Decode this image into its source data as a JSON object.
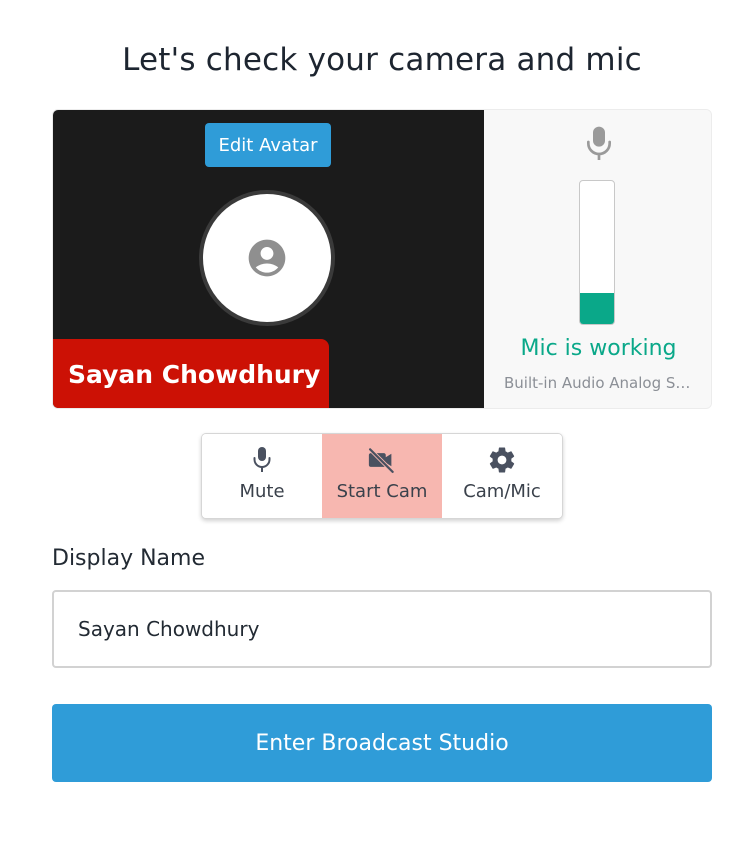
{
  "page": {
    "title": "Let's check your camera and mic"
  },
  "preview": {
    "edit_avatar_label": "Edit Avatar",
    "avatar_icon": "account-circle-icon",
    "name_tag": "Sayan Chowdhury"
  },
  "mic_panel": {
    "icon": "microphone-icon",
    "level": 0.22,
    "status": "Mic is working",
    "device": "Built-in Audio Analog Stereo",
    "status_color": "#0aa889"
  },
  "controls": {
    "mute": {
      "label": "Mute",
      "icon": "microphone-icon"
    },
    "start_cam": {
      "label": "Start Cam",
      "icon": "video-off-icon",
      "active": true
    },
    "cam_mic": {
      "label": "Cam/Mic",
      "icon": "gear-icon"
    }
  },
  "display_name": {
    "label": "Display Name",
    "value": "Sayan Chowdhury"
  },
  "enter_button": {
    "label": "Enter Broadcast Studio"
  },
  "colors": {
    "accent": "#2f9cd8",
    "name_tag_bg": "#cc1105",
    "cam_off_bg": "#f7b7b0"
  }
}
